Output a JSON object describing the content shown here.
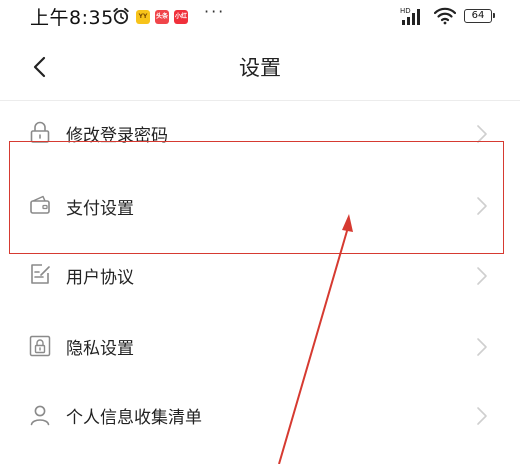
{
  "status_bar": {
    "time": "上午8:35",
    "apps": [
      {
        "name": "yy-app-icon",
        "label": "YY",
        "color": "#f7c31a"
      },
      {
        "name": "toutiao-app-icon",
        "label": "头条",
        "color": "#f0454a"
      },
      {
        "name": "xiaohongshu-app-icon",
        "label": "小红书",
        "color": "#f0303b"
      }
    ],
    "more": "···",
    "network": "HD",
    "battery": "64"
  },
  "nav": {
    "title": "设置"
  },
  "settings": {
    "items": [
      {
        "label": "修改登录密码",
        "icon": "lock-icon"
      },
      {
        "label": "支付设置",
        "icon": "wallet-icon"
      },
      {
        "label": "用户协议",
        "icon": "document-edit-icon"
      },
      {
        "label": "隐私设置",
        "icon": "privacy-lock-icon"
      },
      {
        "label": "个人信息收集清单",
        "icon": "user-icon"
      }
    ]
  },
  "colors": {
    "annotation": "#d63a31",
    "icon": "#8a8a8a",
    "chevron": "#cfcfcf"
  }
}
